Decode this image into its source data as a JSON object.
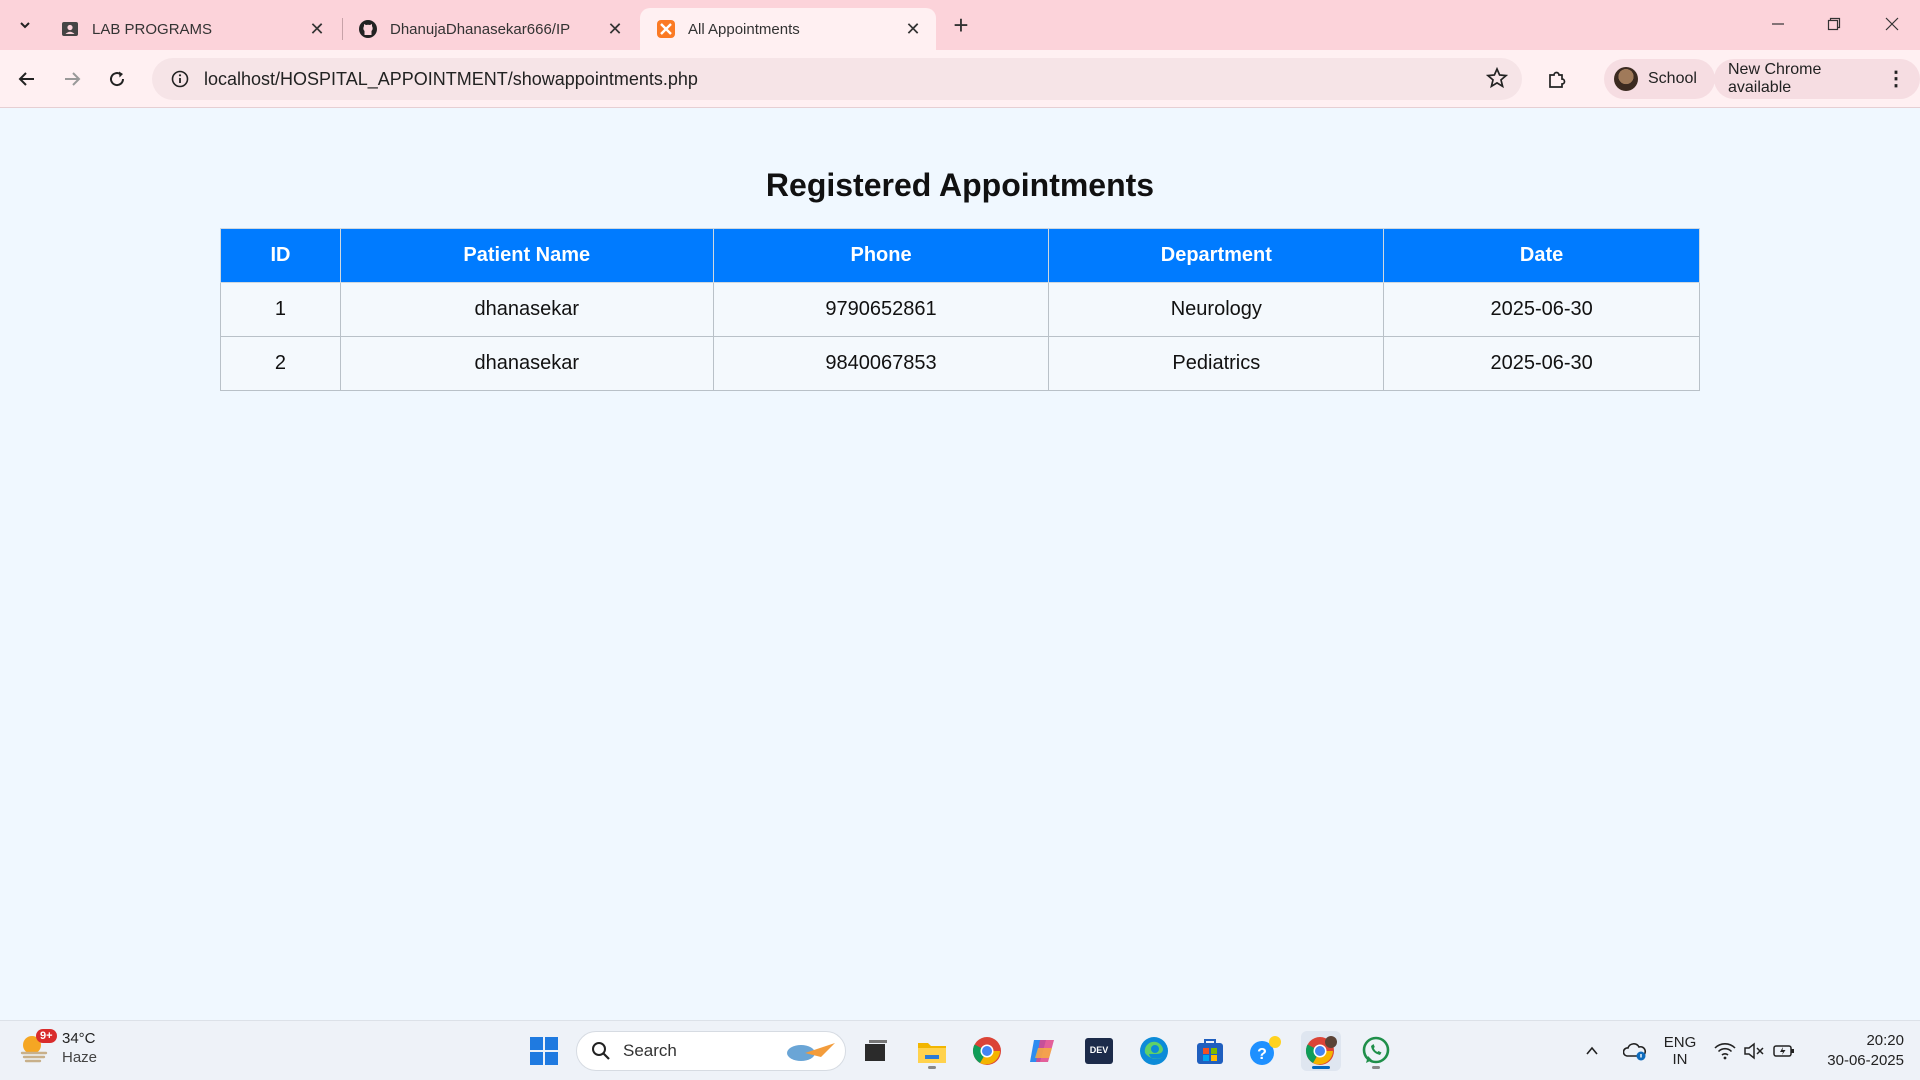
{
  "browser": {
    "tabs": [
      {
        "title": "LAB PROGRAMS",
        "icon": "contact-card-icon",
        "active": false
      },
      {
        "title": "DhanujaDhanasekar666/IP",
        "icon": "github-icon",
        "active": false
      },
      {
        "title": "All Appointments",
        "icon": "xampp-icon",
        "active": true
      }
    ],
    "url": "localhost/HOSPITAL_APPOINTMENT/showappointments.php",
    "profile_label": "School",
    "update_label": "New Chrome available",
    "accent": "#fcd3da"
  },
  "page": {
    "title": "Registered Appointments",
    "table": {
      "headers": [
        "ID",
        "Patient Name",
        "Phone",
        "Department",
        "Date"
      ],
      "header_color": "#007bff",
      "rows": [
        [
          "1",
          "dhanasekar",
          "9790652861",
          "Neurology",
          "2025-06-30"
        ],
        [
          "2",
          "dhanasekar",
          "9840067853",
          "Pediatrics",
          "2025-06-30"
        ]
      ]
    }
  },
  "taskbar": {
    "weather": {
      "temp": "34°C",
      "condition": "Haze",
      "badge": "9+"
    },
    "search_placeholder": "Search",
    "tray": {
      "lang_top": "ENG",
      "lang_bottom": "IN"
    },
    "clock": {
      "time": "20:20",
      "date": "30-06-2025"
    }
  }
}
